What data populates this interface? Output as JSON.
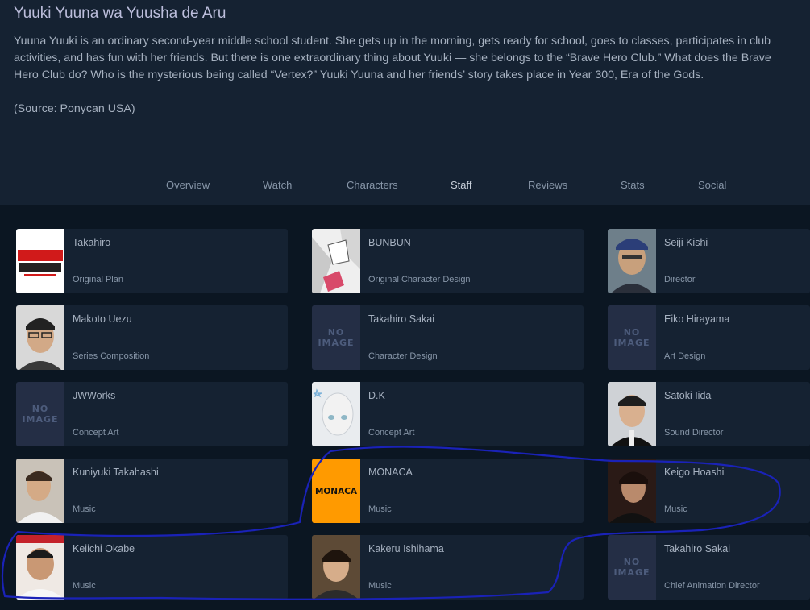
{
  "media": {
    "title": "Yuuki Yuuna wa Yuusha de Aru",
    "description": "Yuuna Yuuki is an ordinary second-year middle school student. She gets up in the morning, gets ready for school, goes to classes, participates in club activities, and has fun with her friends. But there is one extraordinary thing about Yuuki — she belongs to the “Brave Hero Club.” What does the Brave Hero Club do? Who is the mysterious being called “Vertex?” Yuuki Yuuna and her friends’ story takes place in Year 300, Era of the Gods.",
    "source": "(Source: Ponycan USA)"
  },
  "tabs": [
    {
      "label": "Overview"
    },
    {
      "label": "Watch"
    },
    {
      "label": "Characters"
    },
    {
      "label": "Staff",
      "active": true
    },
    {
      "label": "Reviews"
    },
    {
      "label": "Stats"
    },
    {
      "label": "Social"
    }
  ],
  "no_image_text": [
    "NO",
    "IMAGE"
  ],
  "monaca_logo_text": "MONACA",
  "staff": [
    {
      "name": "Takahiro",
      "role": "Original Plan",
      "image": "takahiro-project-logo"
    },
    {
      "name": "BUNBUN",
      "role": "Original Character Design",
      "image": "manga-sketch-photo"
    },
    {
      "name": "Seiji Kishi",
      "role": "Director",
      "image": "person-photo"
    },
    {
      "name": "Makoto Uezu",
      "role": "Series Composition",
      "image": "person-photo"
    },
    {
      "name": "Takahiro Sakai",
      "role": "Character Design",
      "image": "no-image"
    },
    {
      "name": "Eiko Hirayama",
      "role": "Art Design",
      "image": "no-image"
    },
    {
      "name": "JWWorks",
      "role": "Concept Art",
      "image": "no-image"
    },
    {
      "name": "D.K",
      "role": "Concept Art",
      "image": "character-art"
    },
    {
      "name": "Satoki Iida",
      "role": "Sound Director",
      "image": "person-photo"
    },
    {
      "name": "Kuniyuki Takahashi",
      "role": "Music",
      "image": "person-photo"
    },
    {
      "name": "MONACA",
      "role": "Music",
      "image": "monaca-logo"
    },
    {
      "name": "Keigo Hoashi",
      "role": "Music",
      "image": "person-photo"
    },
    {
      "name": "Keiichi Okabe",
      "role": "Music",
      "image": "person-photo"
    },
    {
      "name": "Kakeru Ishihama",
      "role": "Music",
      "image": "person-photo"
    },
    {
      "name": "Takahiro Sakai",
      "role": "Chief Animation Director",
      "image": "no-image"
    }
  ],
  "colors": {
    "page_bg": "#0b1622",
    "card_bg": "#152232",
    "annotation": "#1a22b8",
    "monaca_orange": "#ff9a00"
  }
}
